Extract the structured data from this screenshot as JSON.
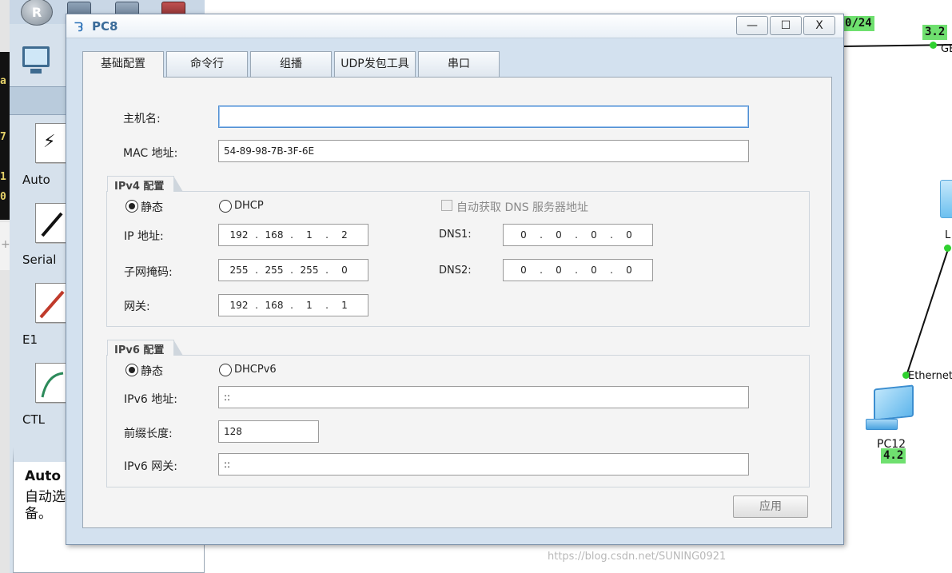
{
  "dialog": {
    "title": "PC8",
    "window_buttons": {
      "minimize": "—",
      "maximize": "☐",
      "close": "X"
    },
    "tabs": [
      {
        "label": "基础配置",
        "active": true
      },
      {
        "label": "命令行",
        "active": false
      },
      {
        "label": "组播",
        "active": false
      },
      {
        "label": "UDP发包工具",
        "active": false
      },
      {
        "label": "串口",
        "active": false
      }
    ],
    "basic": {
      "hostname_label": "主机名:",
      "hostname_value": "",
      "mac_label": "MAC 地址:",
      "mac_value": "54-89-98-7B-3F-6E"
    },
    "ipv4": {
      "group_title": "IPv4 配置",
      "static_label": "静态",
      "dhcp_label": "DHCP",
      "mode": "static",
      "auto_dns_label": "自动获取 DNS 服务器地址",
      "ip_label": "IP 地址:",
      "ip": [
        "192",
        "168",
        "1",
        "2"
      ],
      "mask_label": "子网掩码:",
      "mask": [
        "255",
        "255",
        "255",
        "0"
      ],
      "gateway_label": "网关:",
      "gateway": [
        "192",
        "168",
        "1",
        "1"
      ],
      "dns1_label": "DNS1:",
      "dns1": [
        "0",
        "0",
        "0",
        "0"
      ],
      "dns2_label": "DNS2:",
      "dns2": [
        "0",
        "0",
        "0",
        "0"
      ]
    },
    "ipv6": {
      "group_title": "IPv6 配置",
      "static_label": "静态",
      "dhcp_label": "DHCPv6",
      "mode": "static",
      "addr_label": "IPv6 地址:",
      "addr_value": "::",
      "prefix_label": "前缀长度:",
      "prefix_value": "128",
      "gateway_label": "IPv6 网关:",
      "gateway_value": "::"
    },
    "apply_label": "应用"
  },
  "background": {
    "router_letter": "R",
    "console_chars": [
      "a",
      "7",
      "1",
      "0"
    ],
    "cross_char": "+",
    "cables": [
      {
        "label": "Auto",
        "icon": "auto-cable-icon",
        "glyph": "⚡"
      },
      {
        "label": "Serial",
        "icon": "serial-cable-icon",
        "glyph": ""
      },
      {
        "label": "E1",
        "icon": "e1-cable-icon",
        "glyph": ""
      },
      {
        "label": "CTL",
        "icon": "ctl-cable-icon",
        "glyph": ""
      }
    ],
    "description": {
      "title": "Auto",
      "text": "自动选择\n备。"
    },
    "topology": {
      "label_top": "0/24",
      "label_right": "3.2",
      "label_ge": "GE",
      "label_ethernet": "Ethernet",
      "label_pc": "PC12",
      "label_pc_ip": "4.2",
      "label_sw": "L"
    },
    "watermark": "https://blog.csdn.net/SUNING0921"
  }
}
